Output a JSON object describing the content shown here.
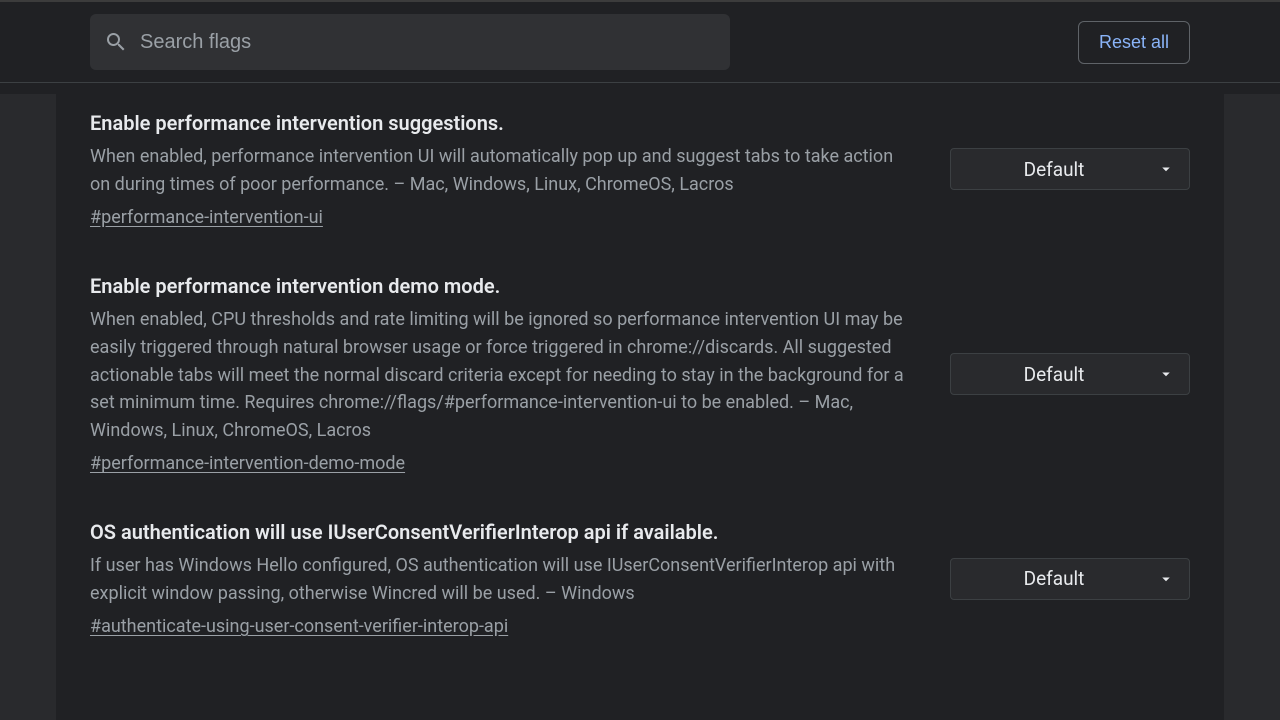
{
  "header": {
    "search_placeholder": "Search flags",
    "reset_label": "Reset all"
  },
  "select_default": "Default",
  "flags": [
    {
      "title": "Enable performance intervention suggestions.",
      "description": "When enabled, performance intervention UI will automatically pop up and suggest tabs to take action on during times of poor performance. – Mac, Windows, Linux, ChromeOS, Lacros",
      "anchor": "#performance-intervention-ui",
      "value": "Default"
    },
    {
      "title": "Enable performance intervention demo mode.",
      "description": "When enabled, CPU thresholds and rate limiting will be ignored so performance intervention UI may be easily triggered through natural browser usage or force triggered in chrome://discards. All suggested actionable tabs will meet the normal discard criteria except for needing to stay in the background for a set minimum time. Requires chrome://flags/#performance-intervention-ui to be enabled. – Mac, Windows, Linux, ChromeOS, Lacros",
      "anchor": "#performance-intervention-demo-mode",
      "value": "Default"
    },
    {
      "title": "OS authentication will use IUserConsentVerifierInterop api if available.",
      "description": "If user has Windows Hello configured, OS authentication will use IUserConsentVerifierInterop api with explicit window passing, otherwise Wincred will be used. – Windows",
      "anchor": "#authenticate-using-user-consent-verifier-interop-api",
      "value": "Default"
    }
  ]
}
